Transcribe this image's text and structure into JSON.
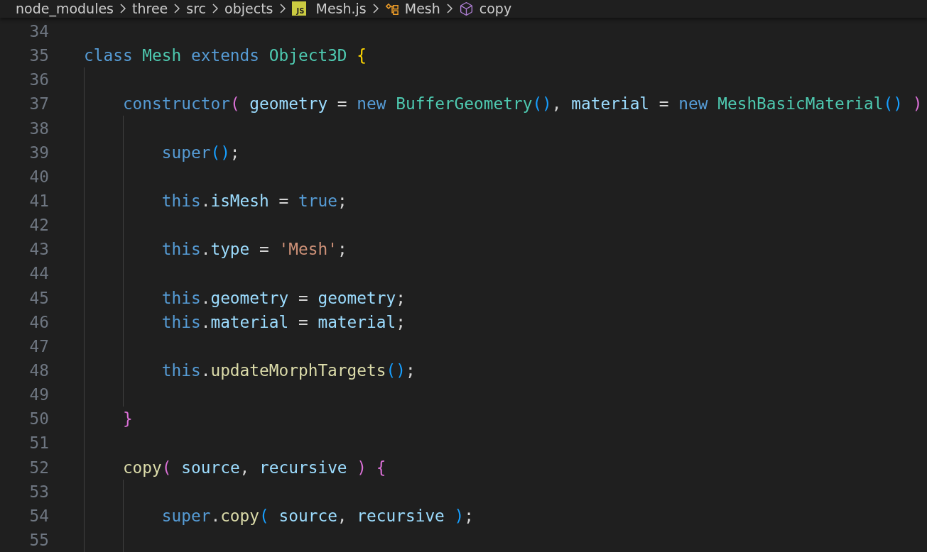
{
  "breadcrumbs": [
    {
      "kind": "folder",
      "label": "node_modules"
    },
    {
      "kind": "folder",
      "label": "three"
    },
    {
      "kind": "folder",
      "label": "src"
    },
    {
      "kind": "folder",
      "label": "objects"
    },
    {
      "kind": "file",
      "label": "Mesh.js",
      "badge": "JS"
    },
    {
      "kind": "class",
      "label": "Mesh"
    },
    {
      "kind": "method",
      "label": "copy"
    }
  ],
  "lines": [
    {
      "number": "34"
    },
    {
      "number": "35",
      "tokens": [
        {
          "kind": "kw",
          "text": "class"
        },
        {
          "kind": "cls",
          "text": " Mesh"
        },
        {
          "kind": "kw",
          "text": " extends"
        },
        {
          "kind": "cls",
          "text": " Object3D"
        },
        {
          "kind": "b1",
          "text": " {"
        }
      ]
    },
    {
      "number": "36"
    },
    {
      "number": "37",
      "tokens": [
        {
          "kind": "kw",
          "text": "    constructor"
        },
        {
          "kind": "b2",
          "text": "("
        },
        {
          "kind": "var",
          "text": " geometry"
        },
        {
          "kind": "p",
          "text": " = "
        },
        {
          "kind": "kw",
          "text": "new"
        },
        {
          "kind": "cls",
          "text": " BufferGeometry"
        },
        {
          "kind": "b3",
          "text": "()"
        },
        {
          "kind": "p",
          "text": ", "
        },
        {
          "kind": "var",
          "text": "material"
        },
        {
          "kind": "p",
          "text": " = "
        },
        {
          "kind": "kw",
          "text": "new"
        },
        {
          "kind": "cls",
          "text": " MeshBasicMaterial"
        },
        {
          "kind": "b3",
          "text": "()"
        },
        {
          "kind": "b2",
          "text": " )"
        }
      ]
    },
    {
      "number": "38"
    },
    {
      "number": "39",
      "tokens": [
        {
          "kind": "kw",
          "text": "        super"
        },
        {
          "kind": "b3",
          "text": "()"
        },
        {
          "kind": "p",
          "text": ";"
        }
      ]
    },
    {
      "number": "40"
    },
    {
      "number": "41",
      "tokens": [
        {
          "kind": "kw",
          "text": "        this"
        },
        {
          "kind": "p",
          "text": "."
        },
        {
          "kind": "var",
          "text": "isMesh"
        },
        {
          "kind": "p",
          "text": " = "
        },
        {
          "kind": "kw",
          "text": "true"
        },
        {
          "kind": "p",
          "text": ";"
        }
      ]
    },
    {
      "number": "42"
    },
    {
      "number": "43",
      "tokens": [
        {
          "kind": "kw",
          "text": "        this"
        },
        {
          "kind": "p",
          "text": "."
        },
        {
          "kind": "var",
          "text": "type"
        },
        {
          "kind": "p",
          "text": " = "
        },
        {
          "kind": "str",
          "text": "'Mesh'"
        },
        {
          "kind": "p",
          "text": ";"
        }
      ]
    },
    {
      "number": "44"
    },
    {
      "number": "45",
      "tokens": [
        {
          "kind": "kw",
          "text": "        this"
        },
        {
          "kind": "p",
          "text": "."
        },
        {
          "kind": "var",
          "text": "geometry"
        },
        {
          "kind": "p",
          "text": " = "
        },
        {
          "kind": "var",
          "text": "geometry"
        },
        {
          "kind": "p",
          "text": ";"
        }
      ]
    },
    {
      "number": "46",
      "tokens": [
        {
          "kind": "kw",
          "text": "        this"
        },
        {
          "kind": "p",
          "text": "."
        },
        {
          "kind": "var",
          "text": "material"
        },
        {
          "kind": "p",
          "text": " = "
        },
        {
          "kind": "var",
          "text": "material"
        },
        {
          "kind": "p",
          "text": ";"
        }
      ]
    },
    {
      "number": "47"
    },
    {
      "number": "48",
      "tokens": [
        {
          "kind": "kw",
          "text": "        this"
        },
        {
          "kind": "p",
          "text": "."
        },
        {
          "kind": "fn",
          "text": "updateMorphTargets"
        },
        {
          "kind": "b3",
          "text": "()"
        },
        {
          "kind": "p",
          "text": ";"
        }
      ]
    },
    {
      "number": "49"
    },
    {
      "number": "50",
      "tokens": [
        {
          "kind": "b2",
          "text": "    }"
        }
      ]
    },
    {
      "number": "51"
    },
    {
      "number": "52",
      "tokens": [
        {
          "kind": "fn",
          "text": "    copy"
        },
        {
          "kind": "b2",
          "text": "("
        },
        {
          "kind": "var",
          "text": " source"
        },
        {
          "kind": "p",
          "text": ", "
        },
        {
          "kind": "var",
          "text": "recursive"
        },
        {
          "kind": "b2",
          "text": " )"
        },
        {
          "kind": "b2",
          "text": " {"
        }
      ]
    },
    {
      "number": "53"
    },
    {
      "number": "54",
      "tokens": [
        {
          "kind": "kw",
          "text": "        super"
        },
        {
          "kind": "p",
          "text": "."
        },
        {
          "kind": "fn",
          "text": "copy"
        },
        {
          "kind": "b3",
          "text": "("
        },
        {
          "kind": "var",
          "text": " source"
        },
        {
          "kind": "p",
          "text": ", "
        },
        {
          "kind": "var",
          "text": "recursive"
        },
        {
          "kind": "b3",
          "text": " )"
        },
        {
          "kind": "p",
          "text": ";"
        }
      ]
    },
    {
      "number": "55"
    }
  ]
}
